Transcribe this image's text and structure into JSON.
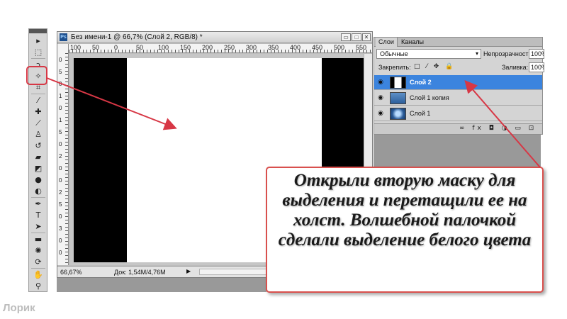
{
  "document": {
    "title": "Без имени-1 @ 66,7% (Слой 2, RGB/8) *",
    "app_icon": "Ps",
    "window_buttons": {
      "minimize": "▭",
      "maximize": "□",
      "close": "✕"
    },
    "ruler_top_labels": [
      "100",
      "50",
      "0",
      "50",
      "100",
      "150",
      "200",
      "250",
      "300",
      "350",
      "400",
      "450",
      "500",
      "550"
    ],
    "ruler_left_labels": [
      "0",
      "5",
      "0",
      "1",
      "0",
      "1",
      "5",
      "0",
      "2",
      "0",
      "0",
      "2",
      "5",
      "0",
      "3",
      "0",
      "0"
    ],
    "zoom": "66,67%",
    "doc_size": "Док: 1,54M/4,76M",
    "status_arrow": "▶"
  },
  "tools": [
    {
      "name": "move-tool-icon",
      "glyph": "▸"
    },
    {
      "name": "marquee-tool-icon",
      "glyph": "⬚"
    },
    {
      "name": "lasso-tool-icon",
      "glyph": "ↄ"
    },
    {
      "name": "magic-wand-tool-icon",
      "glyph": "✧"
    },
    {
      "name": "crop-tool-icon",
      "glyph": "⌗"
    },
    {
      "name": "eyedropper-tool-icon",
      "glyph": "⁄"
    },
    {
      "name": "healing-tool-icon",
      "glyph": "✚"
    },
    {
      "name": "brush-tool-icon",
      "glyph": "⟋"
    },
    {
      "name": "stamp-tool-icon",
      "glyph": "♙"
    },
    {
      "name": "history-brush-tool-icon",
      "glyph": "↺"
    },
    {
      "name": "eraser-tool-icon",
      "glyph": "▰"
    },
    {
      "name": "gradient-tool-icon",
      "glyph": "◩"
    },
    {
      "name": "blur-tool-icon",
      "glyph": "●"
    },
    {
      "name": "dodge-tool-icon",
      "glyph": "◐"
    },
    {
      "name": "pen-tool-icon",
      "glyph": "✒"
    },
    {
      "name": "type-tool-icon",
      "glyph": "T"
    },
    {
      "name": "path-select-tool-icon",
      "glyph": "➤"
    },
    {
      "name": "shape-tool-icon",
      "glyph": "▬"
    },
    {
      "name": "3d-rotate-tool-icon",
      "glyph": "✺"
    },
    {
      "name": "3d-orbit-tool-icon",
      "glyph": "⟳"
    },
    {
      "name": "hand-tool-icon",
      "glyph": "✋"
    },
    {
      "name": "zoom-tool-icon",
      "glyph": "⚲"
    }
  ],
  "layers_panel": {
    "tabs": [
      "Слои",
      "Каналы"
    ],
    "blend_mode": "Обычные",
    "dropdown_arrow": "▾",
    "opacity_label": "Непрозрачность:",
    "opacity_value": "100%",
    "lock_label": "Закрепить:",
    "lock_icons": "□ ⁄ ✥ 🔒",
    "fill_label": "Заливка:",
    "fill_value": "100%",
    "eye_glyph": "◉",
    "layers": [
      {
        "name": "Слой 2",
        "active": true
      },
      {
        "name": "Слой 1 копия",
        "active": false
      },
      {
        "name": "Слой 1",
        "active": false
      }
    ],
    "footer_icons": "∞ fx ◘ ◑ ▭ ⊡"
  },
  "callout": {
    "text": "Открыли вторую маску для выделения и перетащили ее на холст. Волшебной палочкой сделали выделение белого цвета"
  },
  "watermark": "Лорик",
  "colors": {
    "annotation_red": "#d73745",
    "active_layer_blue": "#3b84de"
  }
}
